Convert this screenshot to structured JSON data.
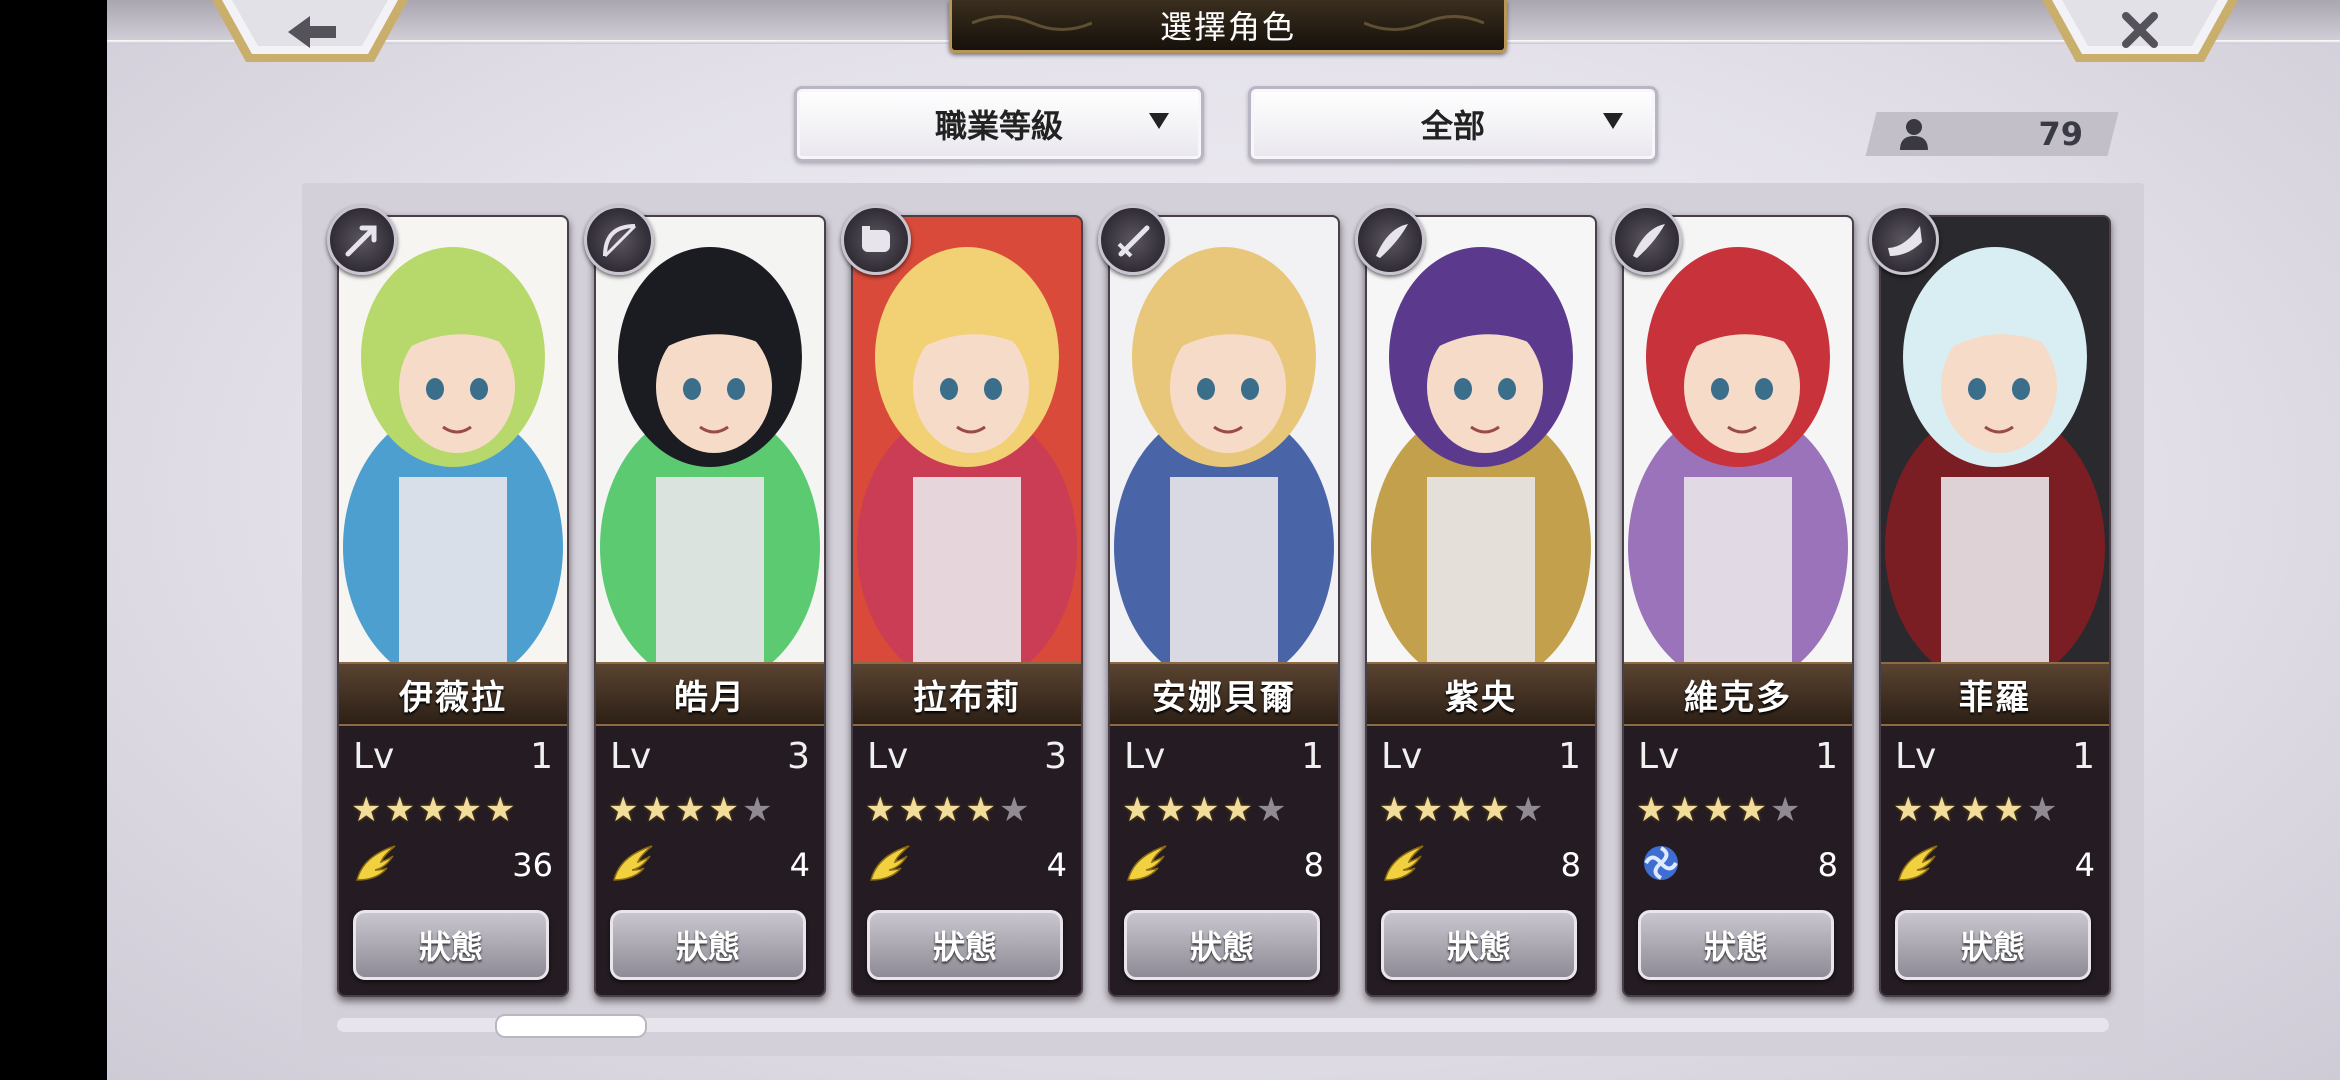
{
  "header": {
    "title": "選擇角色",
    "back_icon": "back-arrow-icon",
    "close_icon": "close-x-icon"
  },
  "filters": {
    "sort_label": "職業等級",
    "filter_label": "全部"
  },
  "roster": {
    "count": "79",
    "icon": "person-icon"
  },
  "characters": [
    {
      "name": "伊薇拉",
      "lv_label": "Lv",
      "level": "1",
      "stars": 5,
      "max_stars": 5,
      "element_icon": "wing-icon",
      "count": "36",
      "status_label": "狀態",
      "job_icon": "arrow-class-icon",
      "colors": {
        "hair": "#b7d86a",
        "bg": "#f6f5f2",
        "accent": "#2f8fc9"
      }
    },
    {
      "name": "皓月",
      "lv_label": "Lv",
      "level": "3",
      "stars": 4,
      "max_stars": 5,
      "element_icon": "wing-icon",
      "count": "4",
      "status_label": "狀態",
      "job_icon": "bow-class-icon",
      "colors": {
        "hair": "#1b1b22",
        "bg": "#f4f4f2",
        "accent": "#3fc25a"
      }
    },
    {
      "name": "拉布莉",
      "lv_label": "Lv",
      "level": "3",
      "stars": 4,
      "max_stars": 5,
      "element_icon": "wing-icon",
      "count": "4",
      "status_label": "狀態",
      "job_icon": "gauntlet-class-icon",
      "colors": {
        "hair": "#f1d173",
        "bg": "#d94a3a",
        "accent": "#c8395a"
      }
    },
    {
      "name": "安娜貝爾",
      "lv_label": "Lv",
      "level": "1",
      "stars": 4,
      "max_stars": 5,
      "element_icon": "wing-icon",
      "count": "8",
      "status_label": "狀態",
      "job_icon": "sword-class-icon",
      "colors": {
        "hair": "#e8c77a",
        "bg": "#f2f2f4",
        "accent": "#2b4c9a"
      }
    },
    {
      "name": "紫央",
      "lv_label": "Lv",
      "level": "1",
      "stars": 4,
      "max_stars": 5,
      "element_icon": "wing-icon",
      "count": "8",
      "status_label": "狀態",
      "job_icon": "blade-class-icon",
      "colors": {
        "hair": "#5b3a8e",
        "bg": "#f6f6f6",
        "accent": "#b8912e"
      }
    },
    {
      "name": "維克多",
      "lv_label": "Lv",
      "level": "1",
      "stars": 4,
      "max_stars": 5,
      "element_icon": "swirl-icon",
      "count": "8",
      "status_label": "狀態",
      "job_icon": "blade-class-icon",
      "colors": {
        "hair": "#c8323a",
        "bg": "#f6f5f5",
        "accent": "#8a5cb0"
      }
    },
    {
      "name": "菲羅",
      "lv_label": "Lv",
      "level": "1",
      "stars": 4,
      "max_stars": 5,
      "element_icon": "wing-icon",
      "count": "4",
      "status_label": "狀態",
      "job_icon": "horn-class-icon",
      "colors": {
        "hair": "#d8eef2",
        "bg": "#2a2a2e",
        "accent": "#8a1c22"
      }
    }
  ]
}
